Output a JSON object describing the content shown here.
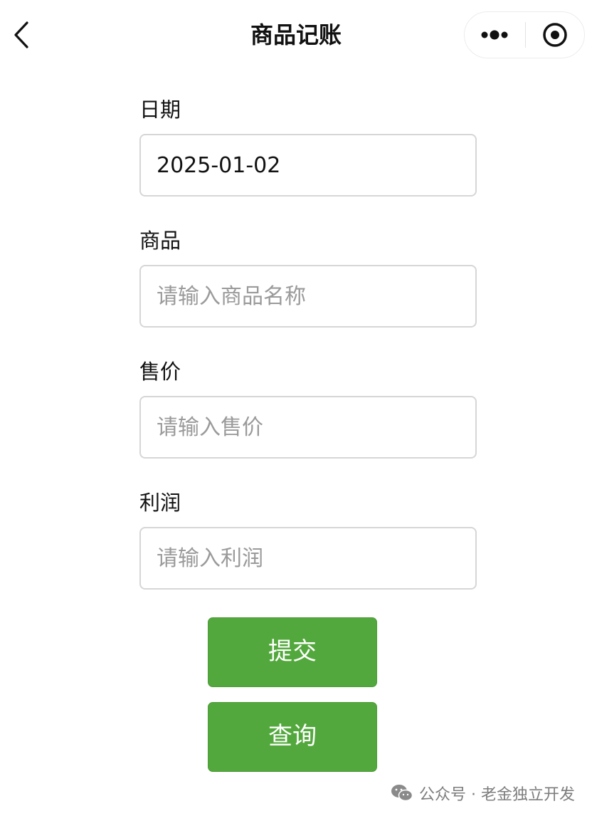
{
  "navbar": {
    "title": "商品记账",
    "back_icon": "chevron-left-icon",
    "more_icon": "more-dots-icon",
    "close_icon": "target-circle-icon"
  },
  "form": {
    "date": {
      "label": "日期",
      "value": "2025-01-02",
      "placeholder": ""
    },
    "product": {
      "label": "商品",
      "value": "",
      "placeholder": "请输入商品名称"
    },
    "price": {
      "label": "售价",
      "value": "",
      "placeholder": "请输入售价"
    },
    "profit": {
      "label": "利润",
      "value": "",
      "placeholder": "请输入利润"
    }
  },
  "buttons": {
    "submit_label": "提交",
    "query_label": "查询",
    "color": "#53a83d"
  },
  "watermark": {
    "text": "公众号 · 老金独立开发",
    "icon": "wechat-icon"
  }
}
